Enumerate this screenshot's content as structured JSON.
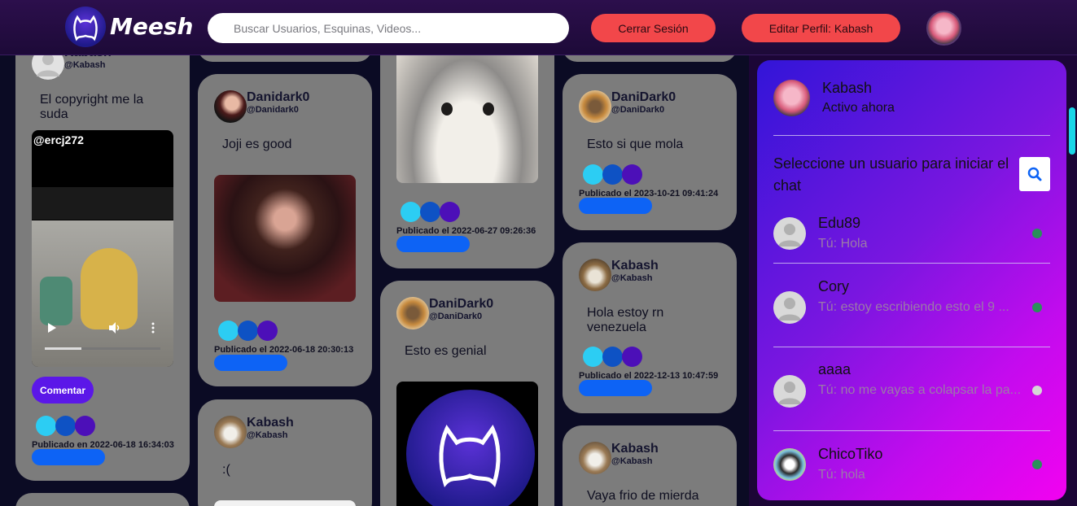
{
  "header": {
    "logo_text": "Meesh",
    "search_placeholder": "Buscar Usuarios, Esquinas, Videos...",
    "logout_label": "Cerrar Sesión",
    "edit_profile_label": "Editar Perfil: Kabash"
  },
  "feed": {
    "col1": {
      "post1": {
        "name": "Kabash",
        "handle": "@Kabash",
        "text": "El copyright me la suda",
        "video_watermark": "@ercj272",
        "comment_label": "Comentar",
        "date": "Publicado en 2022-06-18 16:34:03"
      }
    },
    "col2": {
      "post1": {
        "name": "Danidark0",
        "handle": "@Danidark0",
        "text": "Joji es good",
        "date": "Publicado el 2022-06-18 20:30:13"
      },
      "post2": {
        "name": "Kabash",
        "handle": "@Kabash",
        "text": ":("
      }
    },
    "col3": {
      "post1": {
        "date": "Publicado el 2022-06-27 09:26:36"
      },
      "post2": {
        "name": "DaniDark0",
        "handle": "@DaniDark0",
        "text": "Esto es genial"
      }
    },
    "col4": {
      "post1": {
        "name": "DaniDark0",
        "handle": "@DaniDark0",
        "text": "Esto si que mola",
        "date": "Publicado el 2023-10-21 09:41:24"
      },
      "post2": {
        "name": "Kabash",
        "handle": "@Kabash",
        "text": "Hola estoy rn venezuela",
        "date": "Publicado el 2022-12-13 10:47:59"
      },
      "post3": {
        "name": "Kabash",
        "handle": "@Kabash",
        "text": "Vaya frio de mierda"
      }
    }
  },
  "chat": {
    "me_name": "Kabash",
    "me_status": "Activo ahora",
    "prompt": "Seleccione un usuario para iniciar el chat",
    "users": [
      {
        "name": "Edu89",
        "msg": "Tú: Hola",
        "online": true
      },
      {
        "name": "Cory",
        "msg": "Tú: estoy escribiendo esto el 9 ...",
        "online": true
      },
      {
        "name": "aaaa",
        "msg": "Tú: no me vayas a colapsar la pa...",
        "online": false
      },
      {
        "name": "ChicoTiko",
        "msg": "Tú: hola",
        "online": true
      }
    ]
  },
  "colors": {
    "header_bg": "#2c0f4c",
    "card_bg": "#7c7c7c",
    "button_red": "#f2474a",
    "accent_blue": "#0d63f5",
    "comment_button": "#5b17e8",
    "online_dot": "#2a8f5a",
    "offline_dot": "#d6d6d6"
  }
}
